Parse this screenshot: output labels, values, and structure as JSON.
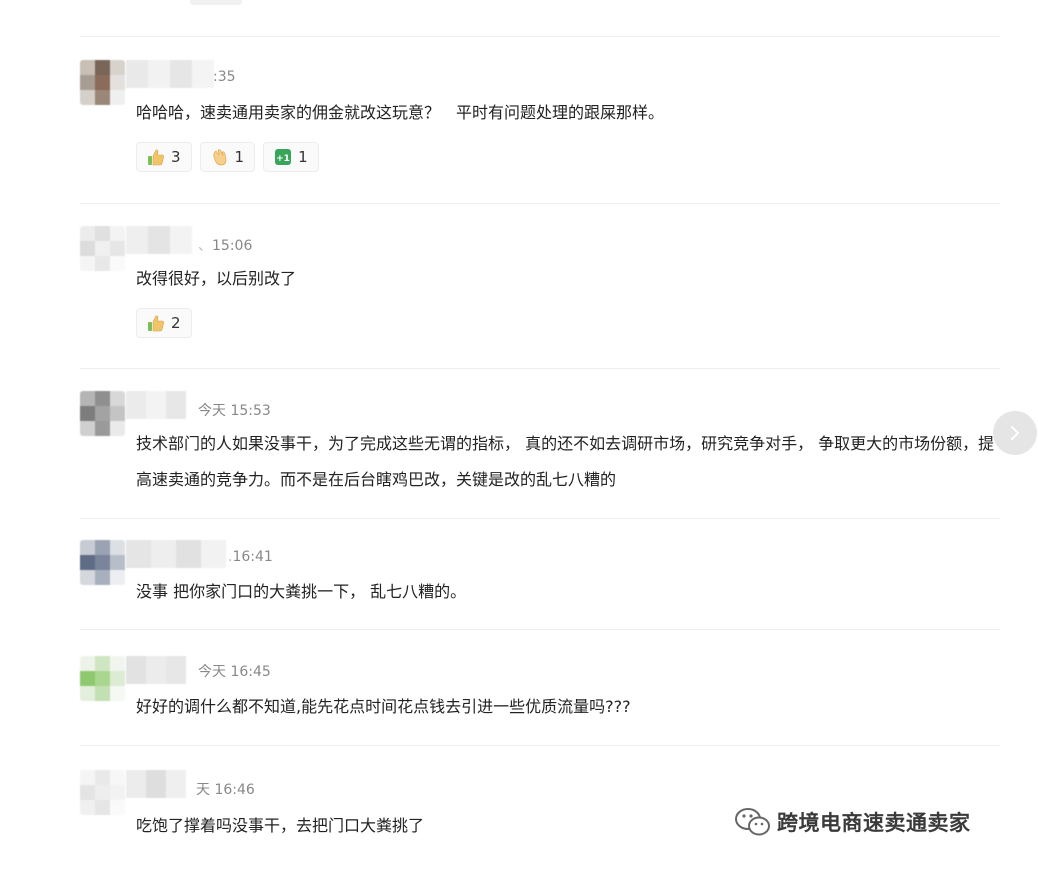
{
  "comments": [
    {
      "time": ":35",
      "text": "哈哈哈，速卖通用卖家的佣金就改这玩意？　平时有问题处理的跟屎那样。",
      "reactions": [
        {
          "emoji": "thumbs-up-icon",
          "count": "3"
        },
        {
          "emoji": "clap-icon",
          "count": "1"
        },
        {
          "emoji": "plus-one-icon",
          "count": "1"
        }
      ]
    },
    {
      "time": "15:06",
      "text": "改得很好，以后别改了",
      "reactions": [
        {
          "emoji": "thumbs-up-icon",
          "count": "2"
        }
      ]
    },
    {
      "time": "今天 15:53",
      "text": "技术部门的人如果没事干，为了完成这些无谓的指标，  真的还不如去调研市场，研究竞争对手，  争取更大的市场份额，提高速卖通的竞争力。而不是在后台瞎鸡巴改，关键是改的乱七八糟的",
      "reactions": []
    },
    {
      "time": "16:41",
      "text": "没事 把你家门口的大粪挑一下，  乱七八糟的。",
      "reactions": []
    },
    {
      "time": "今天 16:45",
      "text": "好好的调什么都不知道,能先花点时间花点钱去引进一些优质流量吗???",
      "reactions": []
    },
    {
      "time": "天 16:46",
      "text": "吃饱了撑着吗没事干，去把门口大粪挑了",
      "reactions": []
    }
  ],
  "watermark": {
    "text": "跨境电商速卖通卖家",
    "icon": "wechat-icon"
  },
  "next_button": {
    "icon": "chevron-right-icon"
  }
}
